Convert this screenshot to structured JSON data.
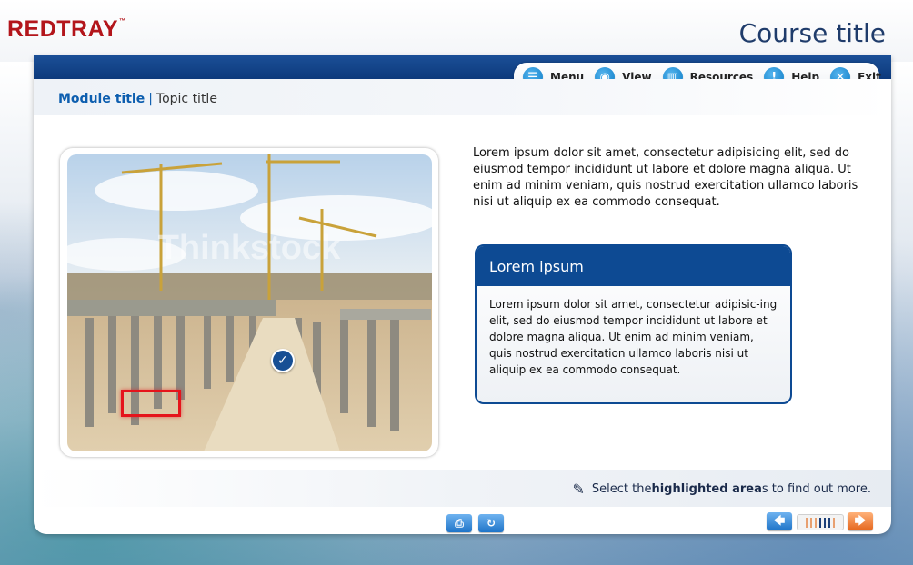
{
  "brand": {
    "logo": "REDTRAY",
    "trademark": "™"
  },
  "course": {
    "title": "Course title"
  },
  "menu": [
    {
      "label": "Menu",
      "icon": "list-icon",
      "glyph": "☰"
    },
    {
      "label": "View",
      "icon": "eye-icon",
      "glyph": "◉"
    },
    {
      "label": "Resources",
      "icon": "books-icon",
      "glyph": "▥"
    },
    {
      "label": "Help",
      "icon": "help-icon",
      "glyph": "!"
    },
    {
      "label": "Exit",
      "icon": "close-icon",
      "glyph": "✕"
    }
  ],
  "breadcrumb": {
    "module": "Module title",
    "separator": "|",
    "topic": "Topic title"
  },
  "photo": {
    "watermark": "Thinkstock"
  },
  "intro": "Lorem ipsum dolor sit amet, consectetur adipisicing elit, sed do eiusmod tempor incididunt ut labore et dolore magna aliqua. Ut enim ad minim veniam, quis nostrud exercitation ullamco laboris nisi ut aliquip ex ea commodo consequat.",
  "info_box": {
    "title": "Lorem ipsum",
    "body": "Lorem ipsum dolor sit amet, consectetur adipisic-ing elit, sed do eiusmod tempor incididunt ut labore et dolore magna aliqua. Ut enim ad minim veniam, quis nostrud exercitation ullamco laboris nisi ut aliquip ex ea commodo consequat."
  },
  "instruction": {
    "pre": "Select the ",
    "bold": "highlighted area",
    "post": "s to find out more."
  },
  "footer": {
    "print_glyph": "⎙",
    "replay_glyph": "↻",
    "back_glyph": "🡄",
    "next_glyph": "🡆",
    "progress": {
      "total": 7,
      "current": [
        3,
        4,
        5
      ]
    }
  },
  "colors": {
    "brand": "#b3151b",
    "navy": "#0d4a93",
    "accent": "#0c7bc5",
    "hotspot": "#e5141b"
  }
}
